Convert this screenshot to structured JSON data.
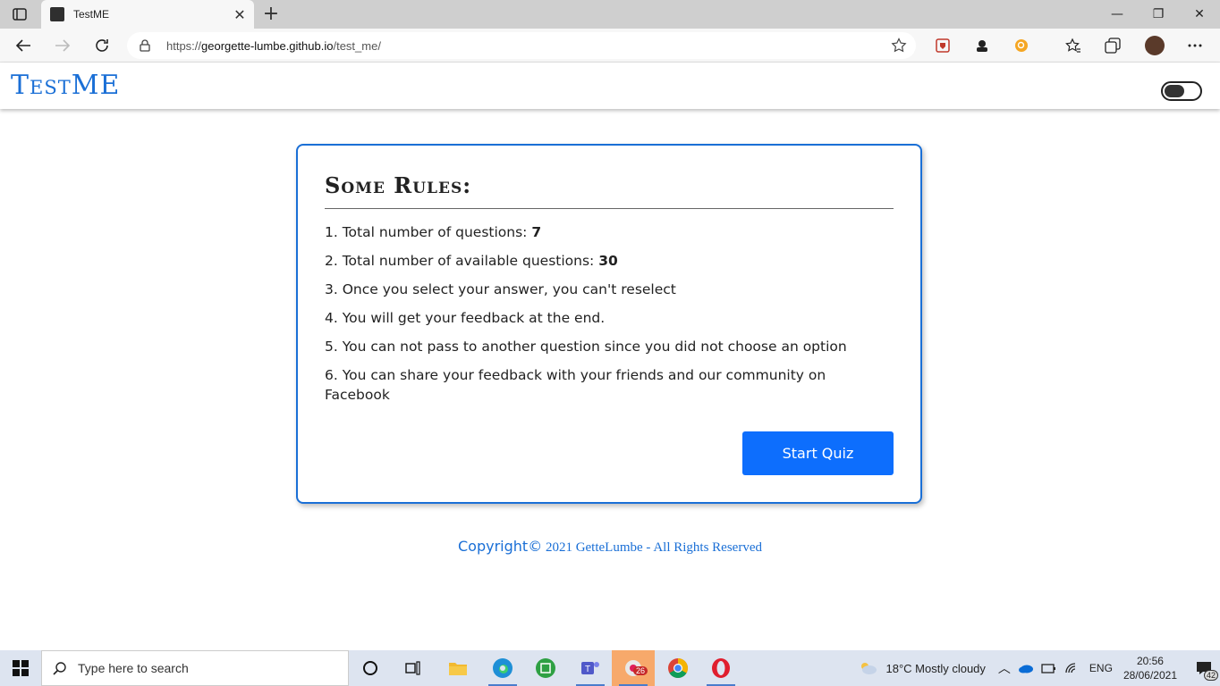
{
  "browser": {
    "tab_title": "TestME",
    "url_prefix": "https://",
    "url_domain": "georgette-lumbe.github.io",
    "url_path": "/test_me/"
  },
  "site": {
    "logo": "TestME"
  },
  "rules": {
    "title": "Some Rules:",
    "items": [
      {
        "text": "1. Total number of questions: ",
        "value": "7"
      },
      {
        "text": "2. Total number of available questions: ",
        "value": "30"
      },
      {
        "text": "3. Once you select your answer, you can't reselect",
        "value": ""
      },
      {
        "text": "4. You will get your feedback at the end.",
        "value": ""
      },
      {
        "text": "5. You can not pass to another question since you did not choose an option",
        "value": ""
      },
      {
        "text": "6. You can share your feedback with your friends and our community on Facebook",
        "value": ""
      }
    ],
    "start_button": "Start Quiz"
  },
  "footer": {
    "copyright_word": "Copyright",
    "copyright_symbol": "©",
    "text": " 2021 GetteLumbe - All Rights Reserved"
  },
  "taskbar": {
    "search_placeholder": "Type here to search",
    "weather": "18°C  Mostly cloudy",
    "language": "ENG",
    "time": "20:56",
    "date": "28/06/2021",
    "notifications": "42",
    "slack_badge": "26"
  },
  "colors": {
    "accent": "#1a6fd6",
    "button": "#0d6efd"
  }
}
